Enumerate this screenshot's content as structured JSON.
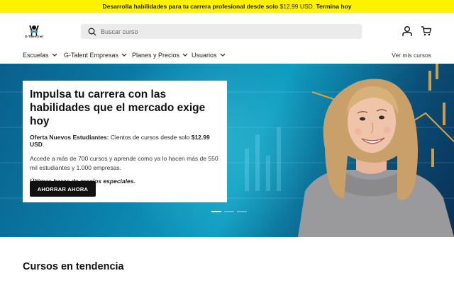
{
  "promo": {
    "text_bold_1": "Desarrolla habilidades para tu carrera profesional desde solo",
    "price": "$12.99 USD.",
    "text_bold_2": "Termina hoy"
  },
  "header": {
    "logo_text": "G-Talent.net",
    "search_placeholder": "Buscar curso",
    "account_icon": "user-icon",
    "cart_icon": "cart-icon"
  },
  "nav": {
    "items": [
      {
        "label": "Escuelas"
      },
      {
        "label": "G-Talent Empresas"
      },
      {
        "label": "Planes y Precios"
      },
      {
        "label": "Usuarios"
      }
    ],
    "right_link": "Ver mis cursos"
  },
  "hero": {
    "title": "Impulsa tu carrera con las habilidades que el mercado exige hoy",
    "offer_label": "Oferta Nuevos Estudiantes:",
    "offer_text": " Cientos de cursos desde solo ",
    "offer_price": "$12.99 USD",
    "offer_end": ".",
    "description": "Accede a más de 700 cursos y aprende como ya lo hacen más de 550 mil estudiantes y 1.000 empresas.",
    "urgency": "Últimas horas de precios especiales.",
    "cta_label": "AHORRAR AHORA",
    "slides_total": 3,
    "active_slide": 1
  },
  "sections": {
    "trending_title": "Cursos en tendencia"
  },
  "colors": {
    "promo_bg": "#fff200",
    "hero_bg": "#0a7ea8",
    "cta_bg": "#111111",
    "chart_line": "#f5a623"
  }
}
